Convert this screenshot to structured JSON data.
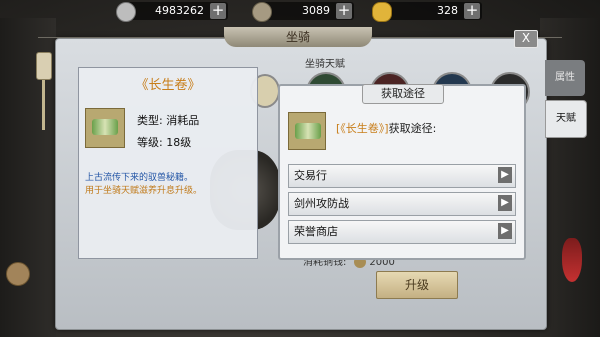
{
  "currencies": [
    {
      "icon": "silver-coin-icon",
      "value": "4983262",
      "plus": "+"
    },
    {
      "icon": "copper-coin-icon",
      "value": "3089",
      "plus": "+"
    },
    {
      "icon": "gold-ingot-icon",
      "value": "328",
      "plus": "+"
    }
  ],
  "window": {
    "title": "坐骑",
    "close": "X"
  },
  "side_tabs": {
    "attributes": "属性",
    "talent": "天赋"
  },
  "talent": {
    "header": "坐骑天赋",
    "cost_label": "消耗铜钱:",
    "cost_value": "2000",
    "upgrade": "升级"
  },
  "item": {
    "name": "《长生卷》",
    "type": "类型: 消耗品",
    "level": "等级: 18级",
    "description": "上古流传下来的驭兽秘籍。",
    "usage": "用于坐骑天赋滋养升息升级。"
  },
  "acquire": {
    "title": "获取途径",
    "item_name": "[《长生卷》]",
    "suffix": "获取途径:",
    "sources": [
      "交易行",
      "剑州攻防战",
      "荣誉商店"
    ]
  },
  "colors": {
    "item_name": "#c87e1a",
    "description": "#2456a6",
    "usage": "#c07a1a"
  }
}
